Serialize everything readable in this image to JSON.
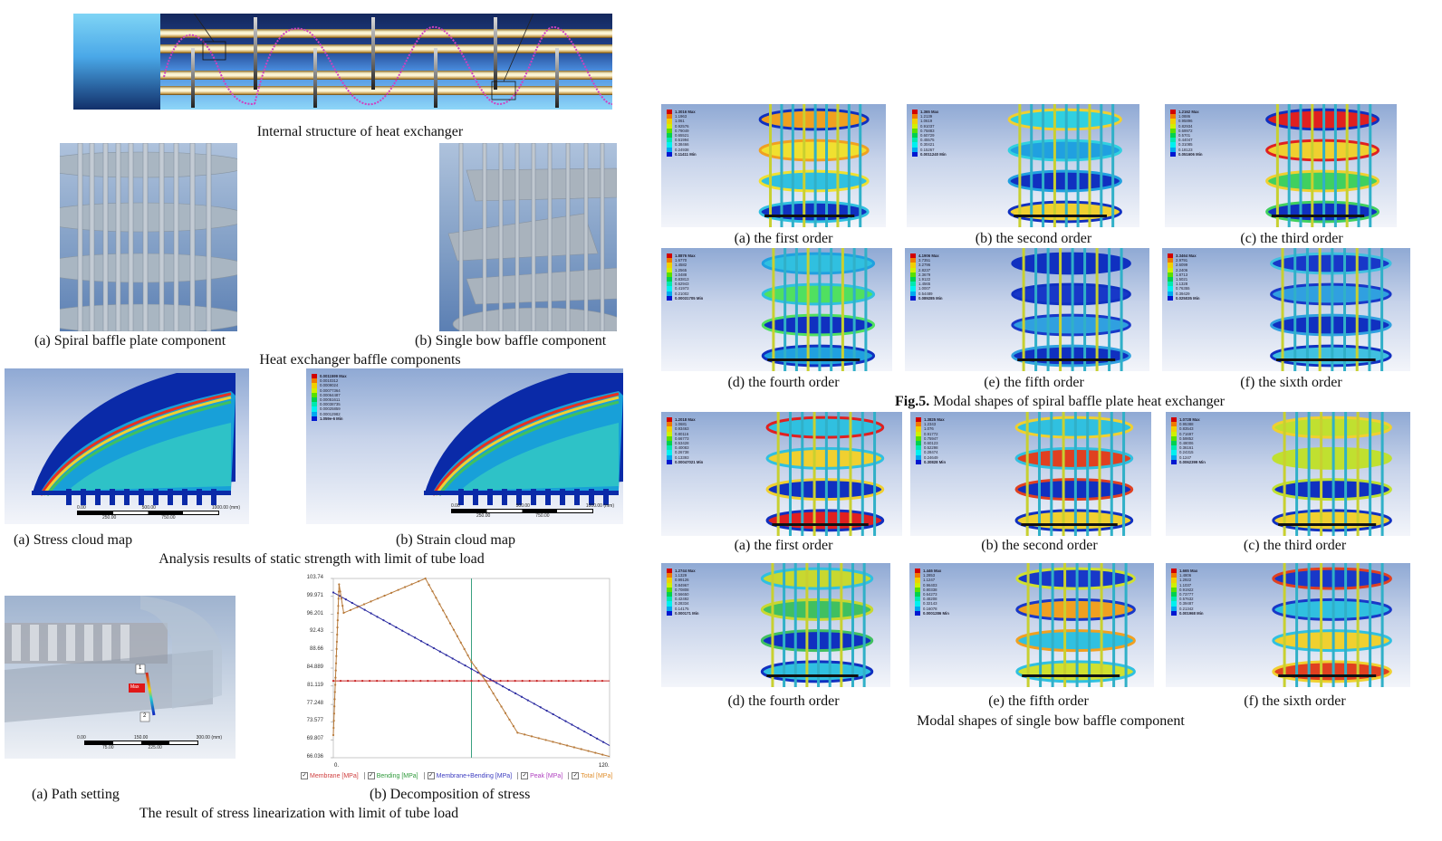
{
  "top": {
    "title": "Internal structure of heat exchanger"
  },
  "baffles": {
    "spiral_caption": "(a) Spiral baffle plate component",
    "bow_caption": "(b) Single bow baffle component",
    "group_caption": "Heat exchanger baffle components"
  },
  "static": {
    "stress_caption": "(a) Stress cloud map",
    "strain_caption": "(b) Strain cloud map",
    "group_caption": "Analysis results of static strength with limit of tube load",
    "strain_legend": [
      "0.0011599 Max",
      "0.0010312",
      "0.0009024",
      "0.00077364",
      "0.00064487",
      "0.00051611",
      "0.00038735",
      "0.00025859",
      "0.00012982",
      "1.059e-6 Min"
    ],
    "scale": {
      "top": [
        "0.00",
        "500.00",
        "1000.00 (mm)"
      ],
      "bottom": [
        "250.00",
        "750.00"
      ]
    }
  },
  "linearization": {
    "path_caption": "(a) Path setting",
    "decomp_caption": "(b) Decomposition of stress",
    "group_caption": "The result of stress linearization with limit of tube load",
    "path_labels": {
      "p1": "1",
      "p2": "2",
      "max": "Max"
    },
    "path_scale": {
      "top": [
        "0.00",
        "150.00",
        "300.00 (mm)"
      ],
      "bottom": [
        "75.00",
        "225.00"
      ]
    }
  },
  "chart_data": {
    "type": "line",
    "title": "",
    "xlabel": "",
    "ylabel": "",
    "x_ticks": [
      "0.",
      "120."
    ],
    "xlim": [
      0,
      120
    ],
    "y_ticks": [
      "103.74",
      "99.971",
      "96.201",
      "92.43",
      "88.66",
      "84.889",
      "81.119",
      "77.248",
      "73.577",
      "69.807",
      "66.036"
    ],
    "ylim": [
      66.036,
      103.74
    ],
    "grid": false,
    "legend": [
      {
        "name": "Membrane [MPa]",
        "color": "#d04040",
        "checked": true
      },
      {
        "name": "Bending [MPa]",
        "color": "#2e9a3a",
        "checked": true
      },
      {
        "name": "Membrane+Bending [MPa]",
        "color": "#3c3cc0",
        "checked": true
      },
      {
        "name": "Peak [MPa]",
        "color": "#b040c0",
        "checked": true
      },
      {
        "name": "Total [MPa]",
        "color": "#e09030",
        "checked": true
      }
    ],
    "legend_position": "bottom",
    "marker_x": 60,
    "series": [
      {
        "name": "Membrane",
        "color": "#c82020",
        "x": [
          0,
          120
        ],
        "y": [
          82.2,
          82.2
        ]
      },
      {
        "name": "Membrane+Bending",
        "color": "#2a2aa0",
        "x": [
          0,
          120
        ],
        "y": [
          100.8,
          68.6
        ]
      },
      {
        "name": "Total",
        "color": "#b87a3a",
        "x": [
          0,
          2.5,
          4.5,
          40,
          60,
          66,
          80,
          120
        ],
        "y": [
          70.8,
          102.5,
          96.5,
          103.74,
          86.2,
          82.3,
          71.3,
          66.3
        ]
      }
    ]
  },
  "spiral_modal": {
    "fig_label": "Fig.5.",
    "fig_caption": " Modal shapes of spiral baffle plate heat exchanger",
    "panels": [
      {
        "caption": "(a) the first order",
        "legend": [
          "1.3016 Max",
          "1.1963",
          "1.061",
          "0.92576",
          "0.79049",
          "0.65521",
          "0.51994",
          "0.38466",
          "0.24938",
          "0.11411 Min"
        ]
      },
      {
        "caption": "(b) the second order",
        "legend": [
          "1.365 Max",
          "1.2139",
          "1.0619",
          "0.91037",
          "0.75883",
          "0.60729",
          "0.45575",
          "0.30421",
          "0.15267",
          "0.0011240 Min"
        ]
      },
      {
        "caption": "(c) the third order",
        "legend": [
          "1.2162 Max",
          "1.0886",
          "0.95896",
          "0.82934",
          "0.69972",
          "0.5701",
          "0.44047",
          "0.31085",
          "0.18123",
          "0.051606 Min"
        ]
      },
      {
        "caption": "(d) the fourth order",
        "legend": [
          "1.8876 Max",
          "1.6770",
          "1.4582",
          "1.2565",
          "1.0488",
          "0.83813",
          "0.62943",
          "0.41973",
          "0.21002",
          "0.00031705 Min"
        ]
      },
      {
        "caption": "(e) the fifth order",
        "legend": [
          "4.1906 Max",
          "3.7351",
          "3.2796",
          "2.8237",
          "2.3679",
          "1.9122",
          "1.4565",
          "1.0007",
          "0.54489",
          "0.089285 Min"
        ]
      },
      {
        "caption": "(f) the sixth order",
        "legend": [
          "3.3464 Max",
          "2.9791",
          "2.6099",
          "2.2406",
          "1.8713",
          "1.5021",
          "1.1328",
          "0.76355",
          "0.39429",
          "0.025035 Min"
        ]
      }
    ]
  },
  "bow_modal": {
    "caption": "Modal shapes of single bow baffle component",
    "panels": [
      {
        "caption": "(a) the first order",
        "legend": [
          "1.2018 Max",
          "1.0681",
          "0.93463",
          "0.80116",
          "0.66773",
          "0.53428",
          "0.40083",
          "0.26738",
          "0.13393",
          "0.00047021 Min"
        ]
      },
      {
        "caption": "(b) the second order",
        "legend": [
          "1.3825 Max",
          "1.2343",
          "1.076",
          "0.91772",
          "0.75947",
          "0.60123",
          "0.52298",
          "0.28474",
          "0.24649",
          "0.30828 Min"
        ]
      },
      {
        "caption": "(c) the third order",
        "legend": [
          "1.0728 Max",
          "0.95388",
          "0.83543",
          "0.71697",
          "0.59852",
          "0.48006",
          "0.36161",
          "0.24315",
          "0.1247",
          "0.0062399 Min"
        ]
      },
      {
        "caption": "(d) the fourth order",
        "legend": [
          "1.2744 Max",
          "1.1329",
          "0.99126",
          "0.84967",
          "0.70808",
          "0.56650",
          "0.42492",
          "0.28334",
          "0.14175",
          "0.000171 Min"
        ]
      },
      {
        "caption": "(e) the fifth order",
        "legend": [
          "1.446 Max",
          "1.2853",
          "1.1247",
          "0.96403",
          "0.80338",
          "0.64273",
          "0.48208",
          "0.32143",
          "0.16078",
          "0.0001286 Min"
        ]
      },
      {
        "caption": "(f) the sixth order",
        "legend": [
          "1.665 Max",
          "1.4806",
          "1.2922",
          "1.1037",
          "0.91922",
          "0.73777",
          "0.57632",
          "0.39487",
          "0.21342",
          "0.001968 Min"
        ]
      }
    ]
  }
}
